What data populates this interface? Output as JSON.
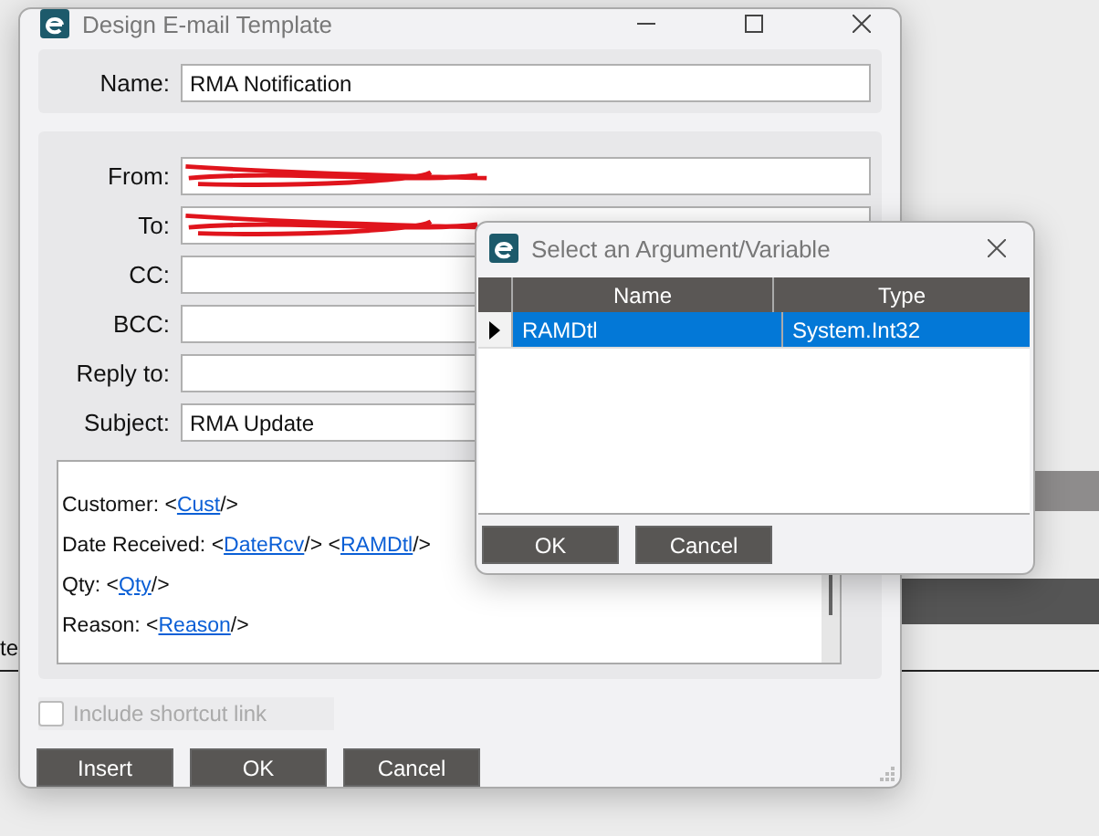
{
  "background": {
    "text_fragment": "te"
  },
  "main_dialog": {
    "title": "Design E-mail Template",
    "name_field": {
      "label": "Name:",
      "value": "RMA Notification"
    },
    "fields": [
      {
        "label": "From:",
        "redacted": true
      },
      {
        "label": "To:",
        "redacted": true
      },
      {
        "label": "CC:",
        "redacted": false
      },
      {
        "label": "BCC:",
        "redacted": false
      },
      {
        "label": "Reply to:",
        "redacted": false
      },
      {
        "label": "Subject:",
        "value": "RMA Update",
        "redacted": false
      }
    ],
    "body_lines": [
      {
        "parts": [
          {
            "kind": "text",
            "text": "Customer:  <"
          },
          {
            "kind": "link",
            "text": "Cust"
          },
          {
            "kind": "text",
            "text": "/>"
          }
        ]
      },
      {
        "parts": [
          {
            "kind": "text",
            "text": "Date Received:  <"
          },
          {
            "kind": "link",
            "text": "DateRcv"
          },
          {
            "kind": "text",
            "text": "/>  <"
          },
          {
            "kind": "link",
            "text": "RAMDtl"
          },
          {
            "kind": "text",
            "text": "/>"
          }
        ]
      },
      {
        "parts": [
          {
            "kind": "text",
            "text": "Qty:  <"
          },
          {
            "kind": "link",
            "text": "Qty"
          },
          {
            "kind": "text",
            "text": "/>"
          }
        ]
      },
      {
        "parts": [
          {
            "kind": "text",
            "text": "Reason:  <"
          },
          {
            "kind": "link",
            "text": "Reason"
          },
          {
            "kind": "text",
            "text": "/>"
          }
        ]
      }
    ],
    "shortcut_checkbox": {
      "label": "Include shortcut link",
      "checked": false,
      "disabled": true
    },
    "buttons": [
      "Insert",
      "OK",
      "Cancel"
    ]
  },
  "argument_dialog": {
    "title": "Select an Argument/Variable",
    "columns": [
      "Name",
      "Type"
    ],
    "rows": [
      {
        "name": "RAMDtl",
        "type": "System.Int32",
        "selected": true
      }
    ],
    "buttons": [
      "OK",
      "Cancel"
    ]
  }
}
